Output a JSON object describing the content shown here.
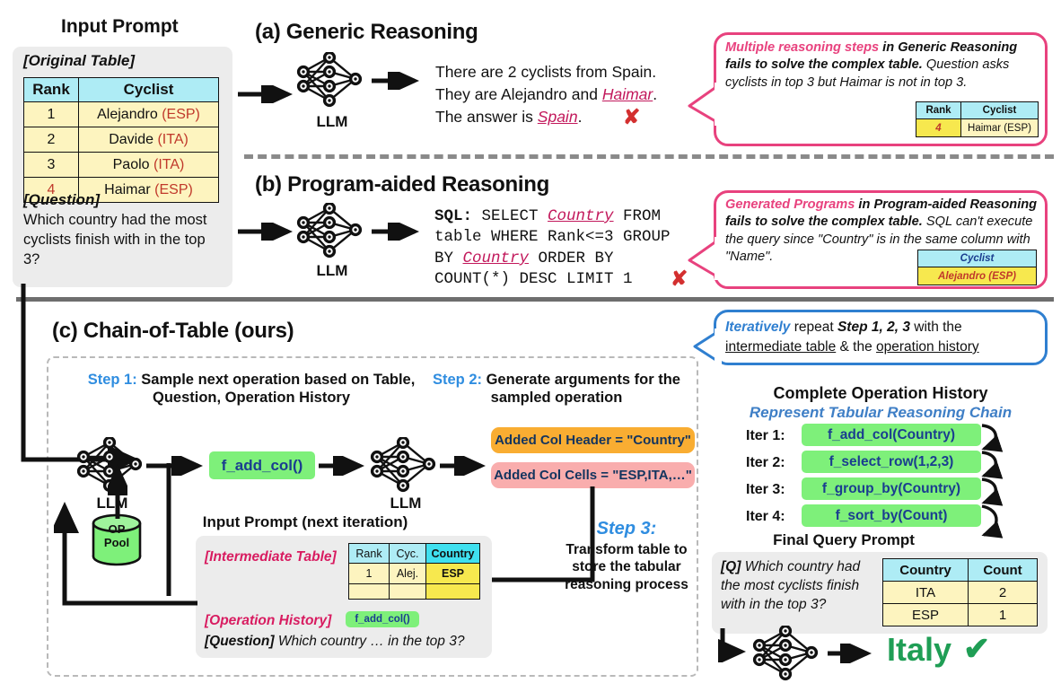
{
  "input_prompt": {
    "title": "Input Prompt",
    "original_table_label": "[Original Table]",
    "table": {
      "headers": [
        "Rank",
        "Cyclist"
      ],
      "rows": [
        {
          "rank": "1",
          "name": "Alejandro",
          "country": "(ESP)"
        },
        {
          "rank": "2",
          "name": "Davide",
          "country": "(ITA)"
        },
        {
          "rank": "3",
          "name": "Paolo",
          "country": "(ITA)"
        },
        {
          "rank": "4",
          "name": "Haimar",
          "country": "(ESP)"
        }
      ]
    },
    "question_label": "[Question]",
    "question_text": "Which country had the most cyclists finish with in the top 3?"
  },
  "section_a": {
    "heading": "(a) Generic Reasoning",
    "llm_label": "LLM",
    "output_line1": "There are 2 cyclists from Spain.",
    "output_line2_pre": "They are Alejandro and ",
    "output_line2_em": "Haimar",
    "output_line2_post": ".",
    "output_line3_pre": "The answer is ",
    "output_line3_em": "Spain",
    "output_line3_post": ".",
    "mark": "✘",
    "callout": {
      "bold_pink": "Multiple reasoning steps",
      "bold_rest": " in Generic Reasoning fails to solve the complex table.",
      "normal": "Question asks cyclists in top 3 but Haimar is not in top 3.",
      "mini_table": {
        "headers": [
          "Rank",
          "Cyclist"
        ],
        "row": [
          "4",
          "Haimar (ESP)"
        ]
      }
    }
  },
  "section_b": {
    "heading": "(b) Program-aided Reasoning",
    "llm_label": "LLM",
    "sql_prefix": "SQL:",
    "sql_p1": " SELECT ",
    "sql_em1": "Country",
    "sql_p2": " FROM table WHERE Rank<=3 GROUP BY ",
    "sql_em2": "Country",
    "sql_p3": " ORDER BY COUNT(*) DESC LIMIT 1",
    "mark": "✘",
    "callout": {
      "bold_pink": "Generated Programs",
      "bold_rest": " in Program-aided Reasoning fails to solve the complex table.",
      "normal": "SQL can't execute the query since \"Country\" is in the same column with \"Name\".",
      "mini_table": {
        "header": "Cyclist",
        "row": "Alejandro (ESP)"
      }
    }
  },
  "section_c": {
    "heading": "(c) Chain-of-Table (ours)",
    "step1": {
      "label": "Step 1:",
      "text": " Sample next operation based on Table, Question, Operation History"
    },
    "step2": {
      "label": "Step 2:",
      "text": " Generate arguments for the sampled operation"
    },
    "step3": {
      "label": "Step 3:",
      "text": "Transform table to store the tabular reasoning process"
    },
    "llm_label": "LLM",
    "op_pool_label_1": "OP",
    "op_pool_label_2": "Pool",
    "sampled_op": "f_add_col()",
    "arg_header": "Added Col Header = \"Country\"",
    "arg_cells": "Added Col Cells = \"ESP,ITA,…\"",
    "next_prompt_title": "Input Prompt (next iteration)",
    "intermediate_table_label": "[Intermediate Table]",
    "intermediate_table": {
      "headers": [
        "Rank",
        "Cyc.",
        "Country"
      ],
      "rows": [
        [
          "1",
          "Alej.",
          "ESP"
        ],
        [
          "",
          "",
          ""
        ]
      ]
    },
    "operation_history_label": "[Operation History]",
    "operation_history_chip": "f_add_col()",
    "question_label": "[Question]",
    "question_text": "Which country … in the top 3?"
  },
  "right_panel": {
    "iter_callout": {
      "blue_em": "Iteratively",
      "p1": " repeat ",
      "bold": "Step 1, 2, 3",
      "p2": " with the ",
      "u1": "intermediate table",
      "p3": " & the ",
      "u2": "operation history"
    },
    "history_title": "Complete Operation History",
    "history_subtitle": "Represent Tabular Reasoning Chain",
    "iterations": [
      {
        "label": "Iter 1:",
        "op": "f_add_col(Country)"
      },
      {
        "label": "Iter 2:",
        "op": "f_select_row(1,2,3)"
      },
      {
        "label": "Iter 3:",
        "op": "f_group_by(Country)"
      },
      {
        "label": "Iter 4:",
        "op": "f_sort_by(Count)"
      }
    ],
    "final_query_title": "Final Query Prompt",
    "final_q_label": "[Q]",
    "final_q_text": " Which country had the most cyclists finish with in the top 3?",
    "final_table": {
      "headers": [
        "Country",
        "Count"
      ],
      "rows": [
        [
          "ITA",
          "2"
        ],
        [
          "ESP",
          "1"
        ]
      ]
    },
    "final_answer": "Italy",
    "final_mark": "✔"
  },
  "colors": {
    "pink": "#e8427e",
    "blue": "#2f7fd0",
    "green_chip": "#7ef07a",
    "orange_chip": "#f9ad32",
    "pink_chip": "#f9adad",
    "table_header": "#aeecf5",
    "table_row": "#fdf4bf",
    "answer_green": "#1f9e55",
    "x_red": "#d32f2f"
  }
}
